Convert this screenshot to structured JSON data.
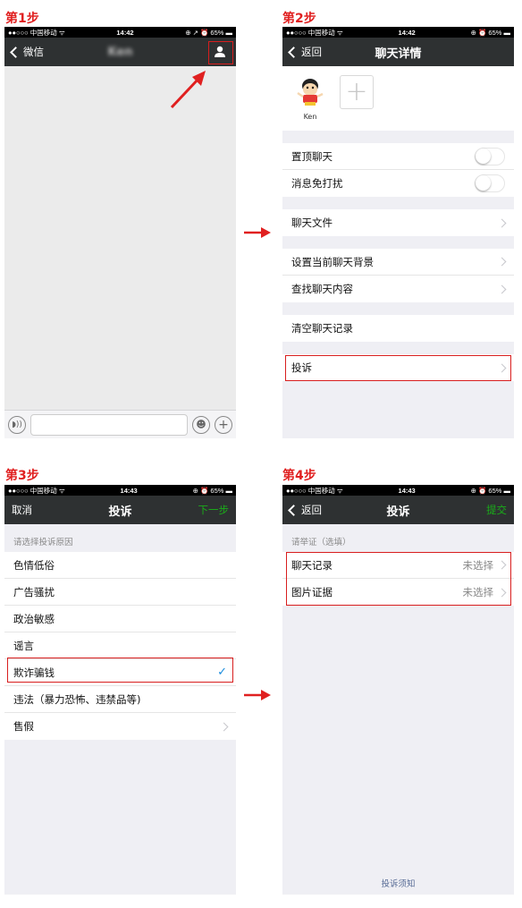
{
  "steps": [
    "第1步",
    "第2步",
    "第3步",
    "第4步"
  ],
  "status1": {
    "carrier": "●●○○○ 中国移动 ᯤ",
    "time": "14:42",
    "battery": "⊕ ↗ ⏰ 65% ▬"
  },
  "status2": {
    "carrier": "●●○○○ 中国移动 ᯤ",
    "time": "14:42",
    "battery": "⊕ ⏰ 65% ▬"
  },
  "status3": {
    "carrier": "●●○○○ 中国移动 ᯤ",
    "time": "14:43",
    "battery": "⊕ ⏰ 65% ▬"
  },
  "status4": {
    "carrier": "●●○○○ 中国移动 ᯤ",
    "time": "14:43",
    "battery": "⊕ ⏰ 65% ▬"
  },
  "screen1": {
    "back": "微信",
    "title": "Ken"
  },
  "screen2": {
    "back": "返回",
    "title": "聊天详情",
    "member_name": "Ken",
    "rows": {
      "pin": "置顶聊天",
      "mute": "消息免打扰",
      "files": "聊天文件",
      "background": "设置当前聊天背景",
      "search": "查找聊天内容",
      "clear": "清空聊天记录",
      "report": "投诉"
    }
  },
  "screen3": {
    "cancel": "取消",
    "title": "投诉",
    "next": "下一步",
    "hint": "请选择投诉原因",
    "reasons": [
      "色情低俗",
      "广告骚扰",
      "政治敏感",
      "谣言",
      "欺诈骗钱",
      "违法（暴力恐怖、违禁品等)",
      "售假"
    ]
  },
  "screen4": {
    "back": "返回",
    "title": "投诉",
    "submit": "提交",
    "hint": "请举证（选填）",
    "rows": [
      {
        "label": "聊天记录",
        "value": "未选择"
      },
      {
        "label": "图片证据",
        "value": "未选择"
      }
    ],
    "footer_link": "投诉须知"
  },
  "colors": {
    "nav": "#2e3132",
    "green": "#1aad19",
    "highlight": "#d81e1e",
    "link": "#576b95"
  }
}
